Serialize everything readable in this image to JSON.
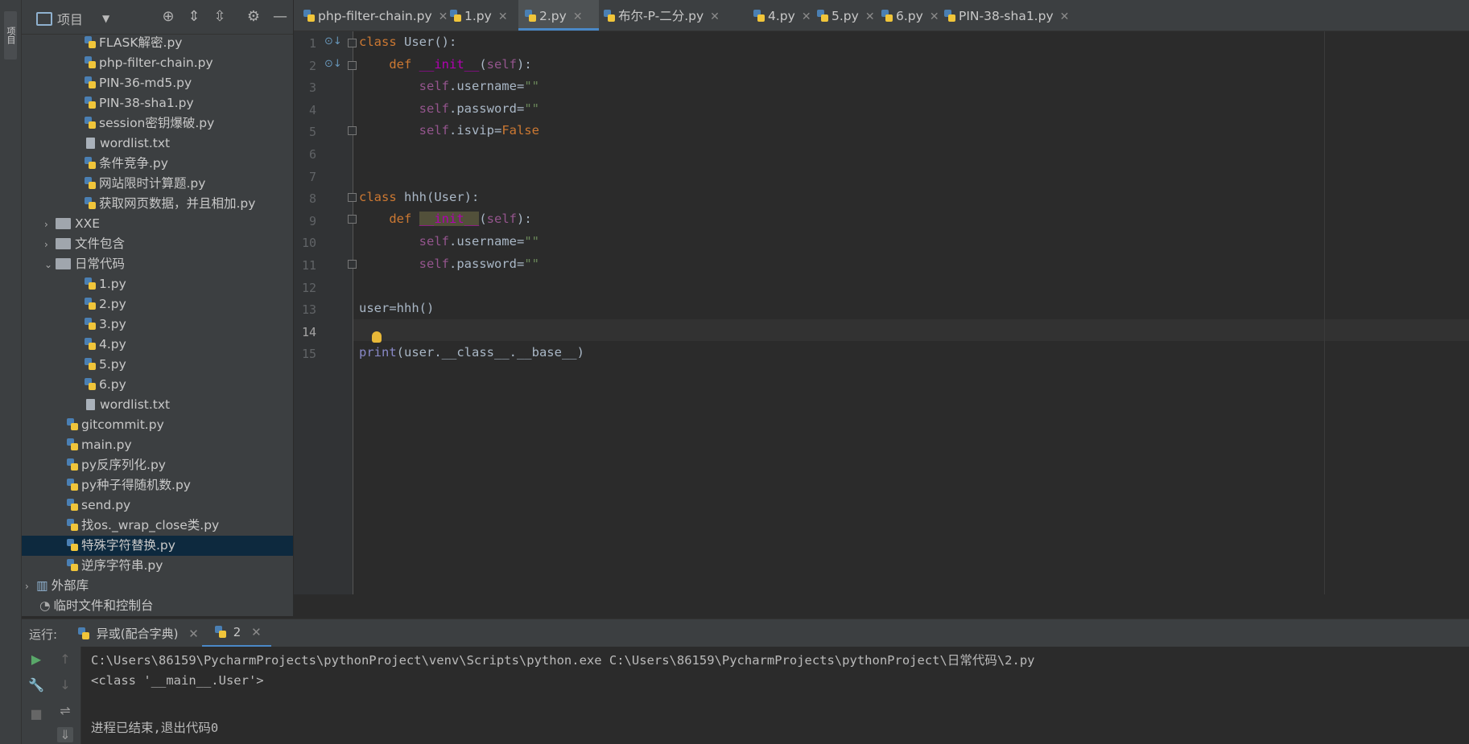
{
  "side_strip": {
    "label": "项目"
  },
  "project_panel": {
    "title": "项目",
    "items": [
      {
        "type": "py",
        "label": "FLASK解密.py"
      },
      {
        "type": "py",
        "label": "php-filter-chain.py"
      },
      {
        "type": "py",
        "label": "PIN-36-md5.py"
      },
      {
        "type": "py",
        "label": "PIN-38-sha1.py"
      },
      {
        "type": "py",
        "label": "session密钥爆破.py"
      },
      {
        "type": "txt",
        "label": "wordlist.txt"
      },
      {
        "type": "py",
        "label": "条件竞争.py"
      },
      {
        "type": "py",
        "label": "网站限时计算题.py"
      },
      {
        "type": "py",
        "label": "获取网页数据，并且相加.py"
      },
      {
        "type": "folder",
        "label": "XXE"
      },
      {
        "type": "folder",
        "label": "文件包含"
      },
      {
        "type": "folder-open",
        "label": "日常代码"
      },
      {
        "type": "py",
        "label": "1.py"
      },
      {
        "type": "py",
        "label": "2.py"
      },
      {
        "type": "py",
        "label": "3.py"
      },
      {
        "type": "py",
        "label": "4.py"
      },
      {
        "type": "py",
        "label": "5.py"
      },
      {
        "type": "py",
        "label": "6.py"
      },
      {
        "type": "txt",
        "label": "wordlist.txt"
      },
      {
        "type": "py",
        "label": "gitcommit.py"
      },
      {
        "type": "py",
        "label": "main.py"
      },
      {
        "type": "py",
        "label": "py反序列化.py"
      },
      {
        "type": "py",
        "label": "py种子得随机数.py"
      },
      {
        "type": "py",
        "label": "send.py"
      },
      {
        "type": "py",
        "label": "找os._wrap_close类.py"
      },
      {
        "type": "py",
        "label": "特殊字符替换.py",
        "selected": true
      },
      {
        "type": "py",
        "label": "逆序字符串.py"
      },
      {
        "type": "lib",
        "label": "外部库"
      },
      {
        "type": "scratch",
        "label": "临时文件和控制台"
      }
    ]
  },
  "tabs": [
    {
      "label": "php-filter-chain.py"
    },
    {
      "label": "1.py"
    },
    {
      "label": "2.py",
      "active": true
    },
    {
      "label": "布尔-P-二分.py"
    },
    {
      "label": "4.py"
    },
    {
      "label": "5.py"
    },
    {
      "label": "6.py"
    },
    {
      "label": "PIN-38-sha1.py"
    }
  ],
  "editor": {
    "line_numbers": [
      "1",
      "2",
      "3",
      "4",
      "5",
      "6",
      "7",
      "8",
      "9",
      "10",
      "11",
      "12",
      "13",
      "14",
      "15"
    ],
    "current_line": 14
  },
  "run_panel": {
    "label": "运行:",
    "tabs": [
      {
        "label": "异或(配合字典)"
      },
      {
        "label": "2",
        "active": true
      }
    ],
    "console": [
      "C:\\Users\\86159\\PycharmProjects\\pythonProject\\venv\\Scripts\\python.exe C:\\Users\\86159\\PycharmProjects\\pythonProject\\日常代码\\2.py",
      "<class '__main__.User'>",
      "",
      "进程已结束,退出代码0"
    ]
  }
}
